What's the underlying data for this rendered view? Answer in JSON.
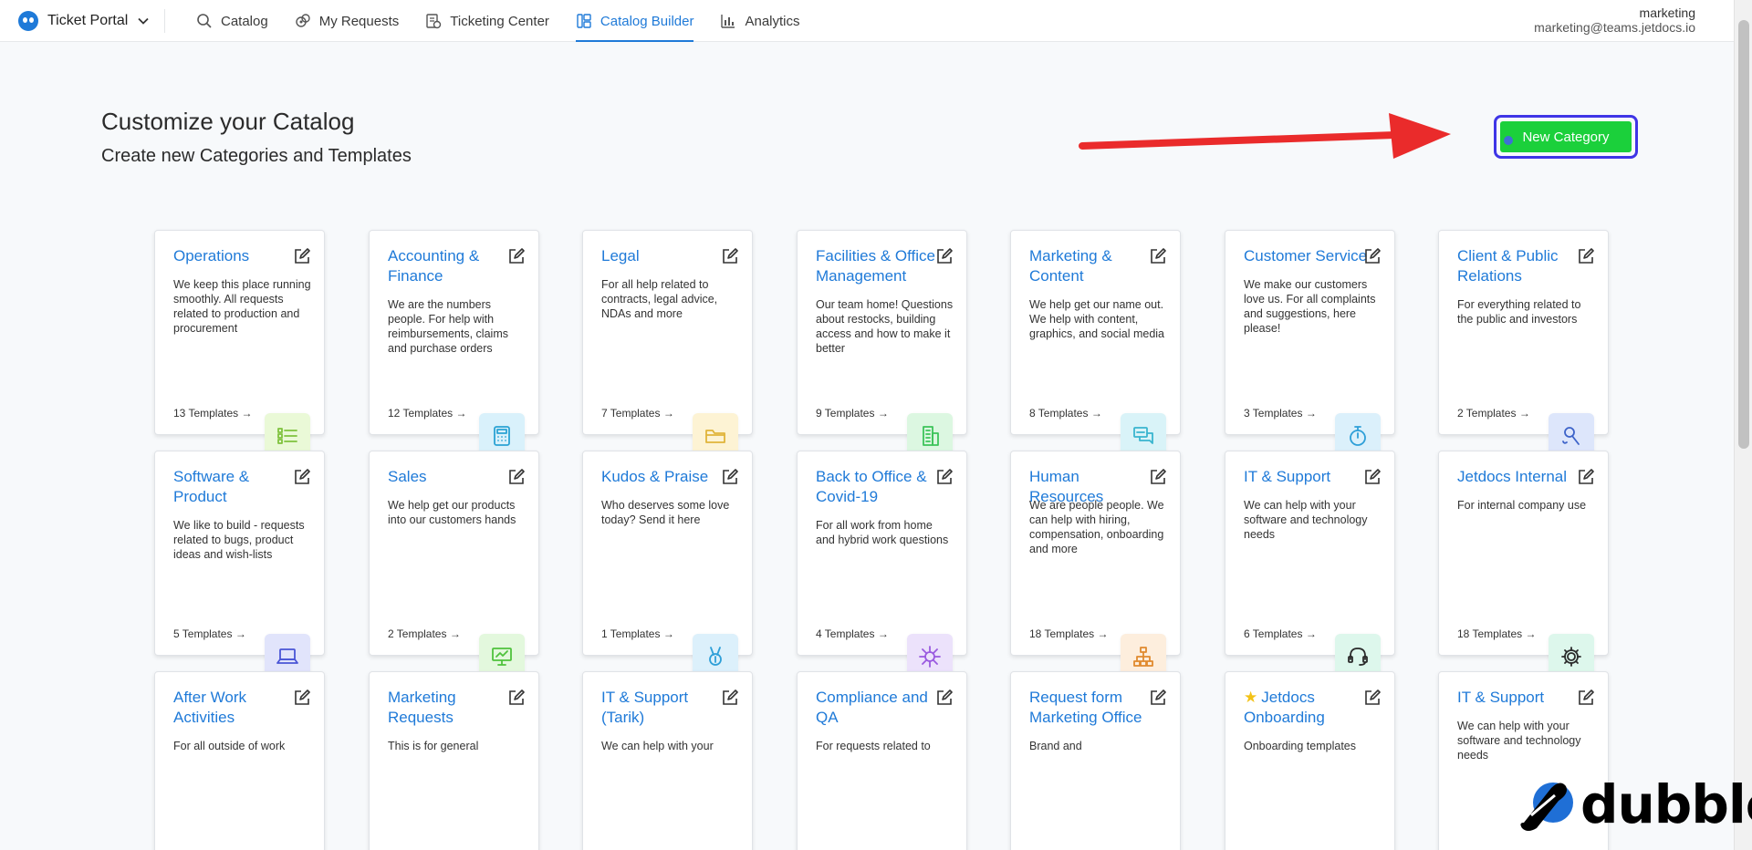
{
  "app": {
    "name": "Ticket Portal"
  },
  "nav": [
    {
      "label": "Catalog",
      "icon": "search-icon"
    },
    {
      "label": "My Requests",
      "icon": "requests-icon"
    },
    {
      "label": "Ticketing Center",
      "icon": "ticketing-icon"
    },
    {
      "label": "Catalog Builder",
      "icon": "builder-icon",
      "active": true
    },
    {
      "label": "Analytics",
      "icon": "analytics-icon"
    }
  ],
  "user": {
    "name": "marketing",
    "email": "marketing@teams.jetdocs.io"
  },
  "page": {
    "title": "Customize your Catalog",
    "subtitle": "Create new Categories and Templates",
    "new_category_label": "New Category"
  },
  "colors": {
    "accent": "#1f7ad8",
    "new_category_bg": "#1bd03b",
    "highlight_border": "#3f35e6",
    "arrow": "#ea2b2b"
  },
  "categories": [
    {
      "title": "Operations",
      "description": "We keep this place running smoothly. All requests related to production and procurement",
      "count": "13 Templates →",
      "icon": "list-icon",
      "badge_bg": "#eaf9d7",
      "badge_color": "#7fc23d"
    },
    {
      "title": "Accounting & Finance",
      "description": "We are the numbers people. For help with reimbursements, claims and purchase orders",
      "count": "12 Templates →",
      "icon": "calculator-icon",
      "badge_bg": "#d9f1fb",
      "badge_color": "#2aa3d4"
    },
    {
      "title": "Legal",
      "description": "For all help related to contracts, legal advice, NDAs and more",
      "count": "7 Templates →",
      "icon": "folder-icon",
      "badge_bg": "#fdf3d4",
      "badge_color": "#e0b43a"
    },
    {
      "title": "Facilities & Office Management",
      "description": "Our team home! Questions about restocks, building access and how to make it better",
      "count": "9 Templates →",
      "icon": "building-icon",
      "badge_bg": "#dcf7e1",
      "badge_color": "#3cc45a"
    },
    {
      "title": "Marketing & Content",
      "description": "We help get our name out. We help with content, graphics, and social media",
      "count": "8 Templates →",
      "icon": "chat-icon",
      "badge_bg": "#d9f3f8",
      "badge_color": "#39b5cf"
    },
    {
      "title": "Customer Service",
      "description": "We make our customers love us. For all complaints and suggestions, here please!",
      "count": "3 Templates →",
      "icon": "stopwatch-icon",
      "badge_bg": "#dbf0fb",
      "badge_color": "#2e9fd8"
    },
    {
      "title": "Client & Public Relations",
      "description": "For everything related to the public and investors",
      "count": "2 Templates →",
      "icon": "microphone-icon",
      "badge_bg": "#dde6fb",
      "badge_color": "#3d63c9"
    },
    {
      "title": "Software & Product",
      "description": "We like to build - requests related to bugs, product ideas and wish-lists",
      "count": "5 Templates →",
      "icon": "laptop-icon",
      "badge_bg": "#e1e4fb",
      "badge_color": "#4a55d6"
    },
    {
      "title": "Sales",
      "description": "We help get our products into our customers hands",
      "count": "2 Templates →",
      "icon": "presentation-icon",
      "badge_bg": "#e3f8dd",
      "badge_color": "#4fc23d"
    },
    {
      "title": "Kudos & Praise",
      "description": "Who deserves some love today? Send it here",
      "count": "1 Templates →",
      "icon": "medal-icon",
      "badge_bg": "#dcf0fb",
      "badge_color": "#2e9fd8"
    },
    {
      "title": "Back to Office & Covid-19",
      "description": "For all work from home and hybrid work questions",
      "count": "4 Templates →",
      "icon": "virus-icon",
      "badge_bg": "#ece2fb",
      "badge_color": "#9a5ae0"
    },
    {
      "title": "Human Resources",
      "description": "We are people people. We can help with hiring, compensation, onboarding and more",
      "count": "18 Templates →",
      "icon": "org-chart-icon",
      "badge_bg": "#fdeedd",
      "badge_color": "#e08a2e"
    },
    {
      "title": "IT & Support",
      "description": "We can help with your software and technology needs",
      "count": "6 Templates →",
      "icon": "headset-icon",
      "badge_bg": "#ddf7ec",
      "badge_color": "#2a2a2a"
    },
    {
      "title": "Jetdocs Internal",
      "description": "For internal company use",
      "count": "18 Templates →",
      "icon": "gear-icon",
      "badge_bg": "#ddf7ec",
      "badge_color": "#2a2a2a"
    },
    {
      "title": "After Work Activities",
      "description": "For all outside of work",
      "count": "",
      "icon": "",
      "badge_bg": "",
      "badge_color": ""
    },
    {
      "title": "Marketing Requests",
      "description": "This is for general",
      "count": "",
      "icon": "",
      "badge_bg": "",
      "badge_color": ""
    },
    {
      "title": "IT & Support (Tarik)",
      "description": "We can help with your",
      "count": "",
      "icon": "",
      "badge_bg": "",
      "badge_color": ""
    },
    {
      "title": "Compliance and QA",
      "description": "For requests related to",
      "count": "",
      "icon": "",
      "badge_bg": "",
      "badge_color": ""
    },
    {
      "title": "Request form Marketing Office",
      "description": "Brand and",
      "count": "",
      "icon": "",
      "badge_bg": "",
      "badge_color": ""
    },
    {
      "title": "Jetdocs Onboarding",
      "description": "Onboarding templates",
      "count": "",
      "icon": "",
      "badge_bg": "",
      "badge_color": "",
      "starred": true
    },
    {
      "title": "IT & Support",
      "description": "We can help with your software and technology needs",
      "count": "",
      "icon": "",
      "badge_bg": "",
      "badge_color": ""
    }
  ],
  "watermark": {
    "text": "dubble"
  }
}
